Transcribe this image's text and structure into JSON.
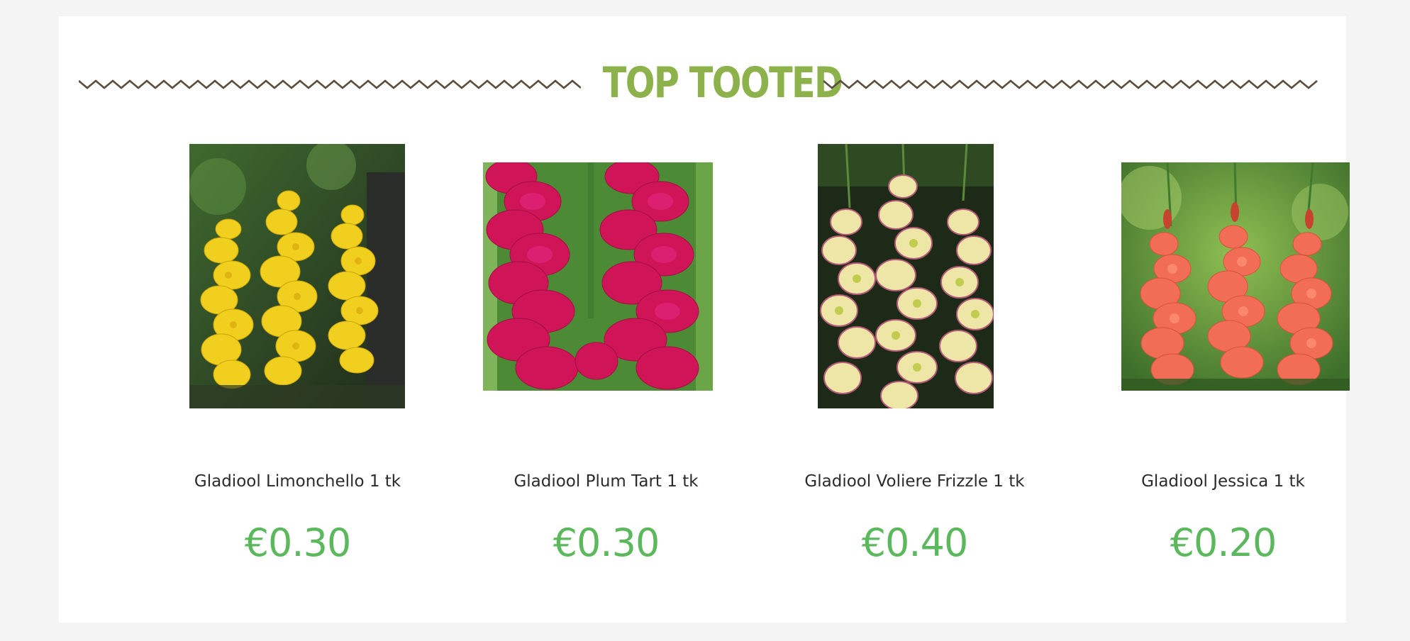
{
  "section": {
    "title": "TOP TOOTED",
    "title_color": "#8db24c",
    "divider_color": "#5b4e3e"
  },
  "price_color": "#5cb85c",
  "products": [
    {
      "name": "Gladiool Limonchello 1 tk",
      "price": "€0.30",
      "image_icon": "yellow-gladiolus-photo",
      "flower_color": "#f0cf1e"
    },
    {
      "name": "Gladiool Plum Tart 1 tk",
      "price": "€0.30",
      "image_icon": "magenta-gladiolus-photo",
      "flower_color": "#d0135a"
    },
    {
      "name": "Gladiool Voliere Frizzle 1 tk",
      "price": "€0.40",
      "image_icon": "cream-pink-gladiolus-photo",
      "flower_color": "#eee6a6"
    },
    {
      "name": "Gladiool Jessica 1 tk",
      "price": "€0.20",
      "image_icon": "salmon-gladiolus-photo",
      "flower_color": "#f26d55"
    }
  ]
}
